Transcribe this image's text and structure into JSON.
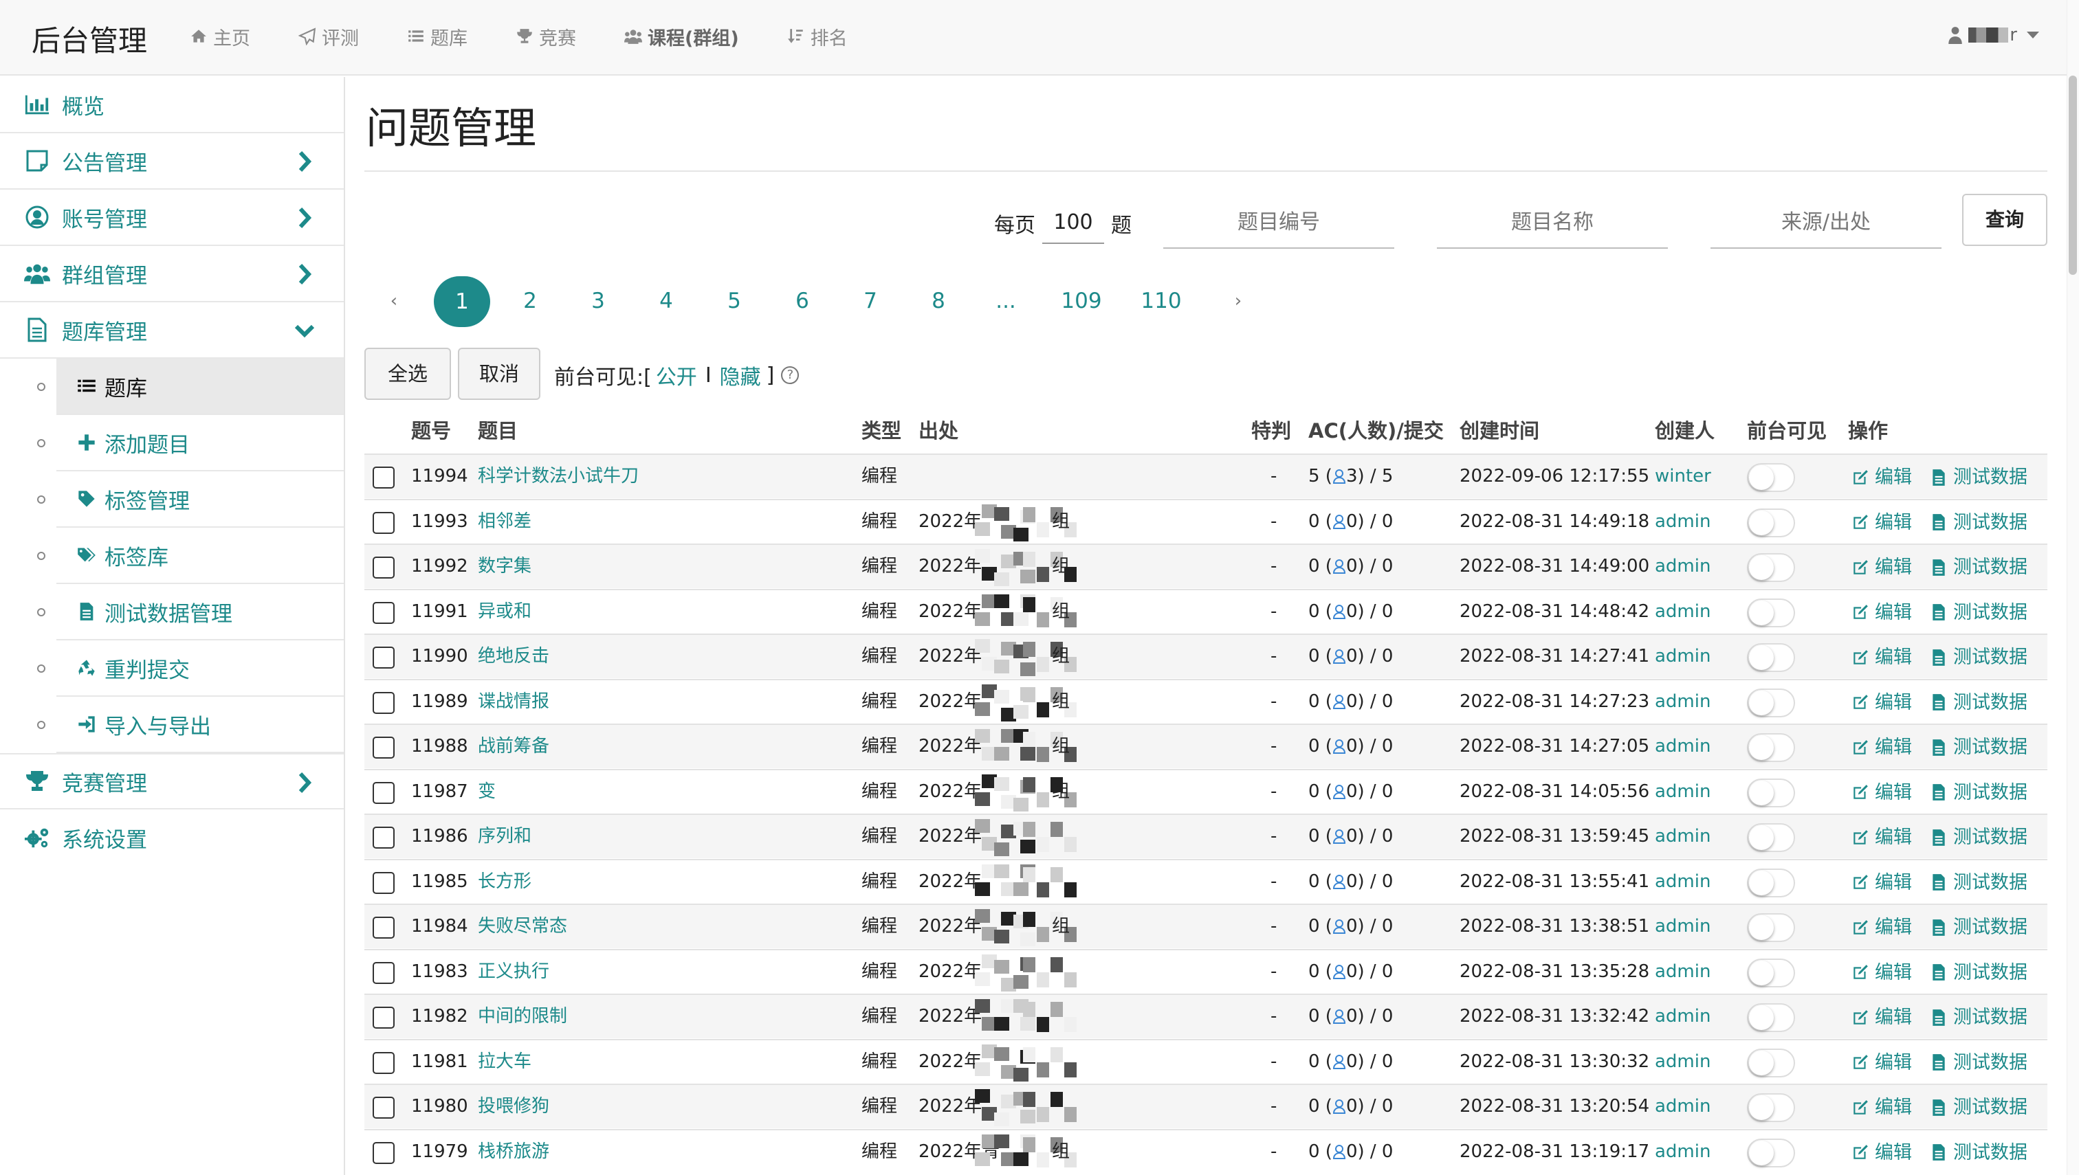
{
  "navbar": {
    "brand": "后台管理",
    "items": [
      {
        "label": "主页",
        "icon": "home-icon"
      },
      {
        "label": "评测",
        "icon": "paper-plane-icon"
      },
      {
        "label": "题库",
        "icon": "list-icon"
      },
      {
        "label": "竞赛",
        "icon": "trophy-icon"
      },
      {
        "label": "课程(群组)",
        "icon": "group-icon"
      },
      {
        "label": "排名",
        "icon": "sort-icon"
      }
    ],
    "user": "r"
  },
  "sidebar": {
    "overview": "概览",
    "announcements": "公告管理",
    "accounts": "账号管理",
    "groups": "群组管理",
    "problems": "题库管理",
    "sub": [
      "题库",
      "添加题目",
      "标签管理",
      "标签库",
      "测试数据管理",
      "重判提交",
      "导入与导出"
    ],
    "contests": "竞赛管理",
    "settings": "系统设置"
  },
  "main": {
    "title": "问题管理",
    "per_page_label": "每页",
    "per_page_value": "100",
    "per_page_unit": "题",
    "filter_id": "题目编号",
    "filter_name": "题目名称",
    "filter_source": "来源/出处",
    "query": "查询",
    "pagination": [
      "‹",
      "1",
      "2",
      "3",
      "4",
      "5",
      "6",
      "7",
      "8",
      "...",
      "109",
      "110",
      "›"
    ],
    "select_all": "全选",
    "cancel": "取消",
    "visible_prefix": "前台可见:[",
    "visible_public": "公开",
    "visible_sep": "I",
    "visible_hidden": "隐藏",
    "visible_suffix": "]",
    "help": "?"
  },
  "table": {
    "headers": {
      "id": "题号",
      "title": "题目",
      "type": "类型",
      "source": "出处",
      "special": "特判",
      "ac": "AC(人数)/提交",
      "created": "创建时间",
      "creator": "创建人",
      "visible": "前台可见",
      "ops": "操作"
    },
    "edit_label": "编辑",
    "testdata_label": "测试数据",
    "rows": [
      {
        "id": "11994",
        "title": "科学计数法小试牛刀",
        "type": "编程",
        "source_a": "",
        "source_b": "",
        "special": "-",
        "ac_a": "5 (",
        "ac_b": "3) / 5",
        "created": "2022-09-06 12:17:55",
        "creator": "winter",
        "visible": false
      },
      {
        "id": "11993",
        "title": "相邻差",
        "type": "编程",
        "source_a": "2022年",
        "source_b": "组",
        "special": "-",
        "ac_a": "0 (",
        "ac_b": "0) / 0",
        "created": "2022-08-31 14:49:18",
        "creator": "admin",
        "visible": false
      },
      {
        "id": "11992",
        "title": "数字集",
        "type": "编程",
        "source_a": "2022年",
        "source_b": "组",
        "special": "-",
        "ac_a": "0 (",
        "ac_b": "0) / 0",
        "created": "2022-08-31 14:49:00",
        "creator": "admin",
        "visible": false
      },
      {
        "id": "11991",
        "title": "异或和",
        "type": "编程",
        "source_a": "2022年",
        "source_b": "组",
        "special": "-",
        "ac_a": "0 (",
        "ac_b": "0) / 0",
        "created": "2022-08-31 14:48:42",
        "creator": "admin",
        "visible": false
      },
      {
        "id": "11990",
        "title": "绝地反击",
        "type": "编程",
        "source_a": "2022年",
        "source_b": "组",
        "special": "-",
        "ac_a": "0 (",
        "ac_b": "0) / 0",
        "created": "2022-08-31 14:27:41",
        "creator": "admin",
        "visible": false
      },
      {
        "id": "11989",
        "title": "谍战情报",
        "type": "编程",
        "source_a": "2022年",
        "source_b": "组",
        "special": "-",
        "ac_a": "0 (",
        "ac_b": "0) / 0",
        "created": "2022-08-31 14:27:23",
        "creator": "admin",
        "visible": false
      },
      {
        "id": "11988",
        "title": "战前筹备",
        "type": "编程",
        "source_a": "2022年",
        "source_b": "组",
        "special": "-",
        "ac_a": "0 (",
        "ac_b": "0) / 0",
        "created": "2022-08-31 14:27:05",
        "creator": "admin",
        "visible": false
      },
      {
        "id": "11987",
        "title": "变",
        "type": "编程",
        "source_a": "2022年",
        "source_b": "组",
        "special": "-",
        "ac_a": "0 (",
        "ac_b": "0) / 0",
        "created": "2022-08-31 14:05:56",
        "creator": "admin",
        "visible": false
      },
      {
        "id": "11986",
        "title": "序列和",
        "type": "编程",
        "source_a": "2022年",
        "source_b": "",
        "special": "-",
        "ac_a": "0 (",
        "ac_b": "0) / 0",
        "created": "2022-08-31 13:59:45",
        "creator": "admin",
        "visible": false
      },
      {
        "id": "11985",
        "title": "长方形",
        "type": "编程",
        "source_a": "2022年",
        "source_b": "",
        "special": "-",
        "ac_a": "0 (",
        "ac_b": "0) / 0",
        "created": "2022-08-31 13:55:41",
        "creator": "admin",
        "visible": false
      },
      {
        "id": "11984",
        "title": "失败尽常态",
        "type": "编程",
        "source_a": "2022年",
        "source_b": "组",
        "special": "-",
        "ac_a": "0 (",
        "ac_b": "0) / 0",
        "created": "2022-08-31 13:38:51",
        "creator": "admin",
        "visible": false
      },
      {
        "id": "11983",
        "title": "正义执行",
        "type": "编程",
        "source_a": "2022年",
        "source_b": "",
        "special": "-",
        "ac_a": "0 (",
        "ac_b": "0) / 0",
        "created": "2022-08-31 13:35:28",
        "creator": "admin",
        "visible": false
      },
      {
        "id": "11982",
        "title": "中间的限制",
        "type": "编程",
        "source_a": "2022年",
        "source_b": "",
        "special": "-",
        "ac_a": "0 (",
        "ac_b": "0) / 0",
        "created": "2022-08-31 13:32:42",
        "creator": "admin",
        "visible": false
      },
      {
        "id": "11981",
        "title": "拉大车",
        "type": "编程",
        "source_a": "2022年",
        "source_b": "",
        "special": "-",
        "ac_a": "0 (",
        "ac_b": "0) / 0",
        "created": "2022-08-31 13:30:32",
        "creator": "admin",
        "visible": false
      },
      {
        "id": "11980",
        "title": "投喂修狗",
        "type": "编程",
        "source_a": "2022年",
        "source_b": "",
        "special": "-",
        "ac_a": "0 (",
        "ac_b": "0) / 0",
        "created": "2022-08-31 13:20:54",
        "creator": "admin",
        "visible": false
      },
      {
        "id": "11979",
        "title": "栈桥旅游",
        "type": "编程",
        "source_a": "2022年青",
        "source_b": "组",
        "special": "-",
        "ac_a": "0 (",
        "ac_b": "0) / 0",
        "created": "2022-08-31 13:19:17",
        "creator": "admin",
        "visible": false
      }
    ]
  },
  "colors": {
    "accent": "#1d8a8a",
    "link": "#1d8a8a",
    "user_icon": "#3a86d4"
  }
}
